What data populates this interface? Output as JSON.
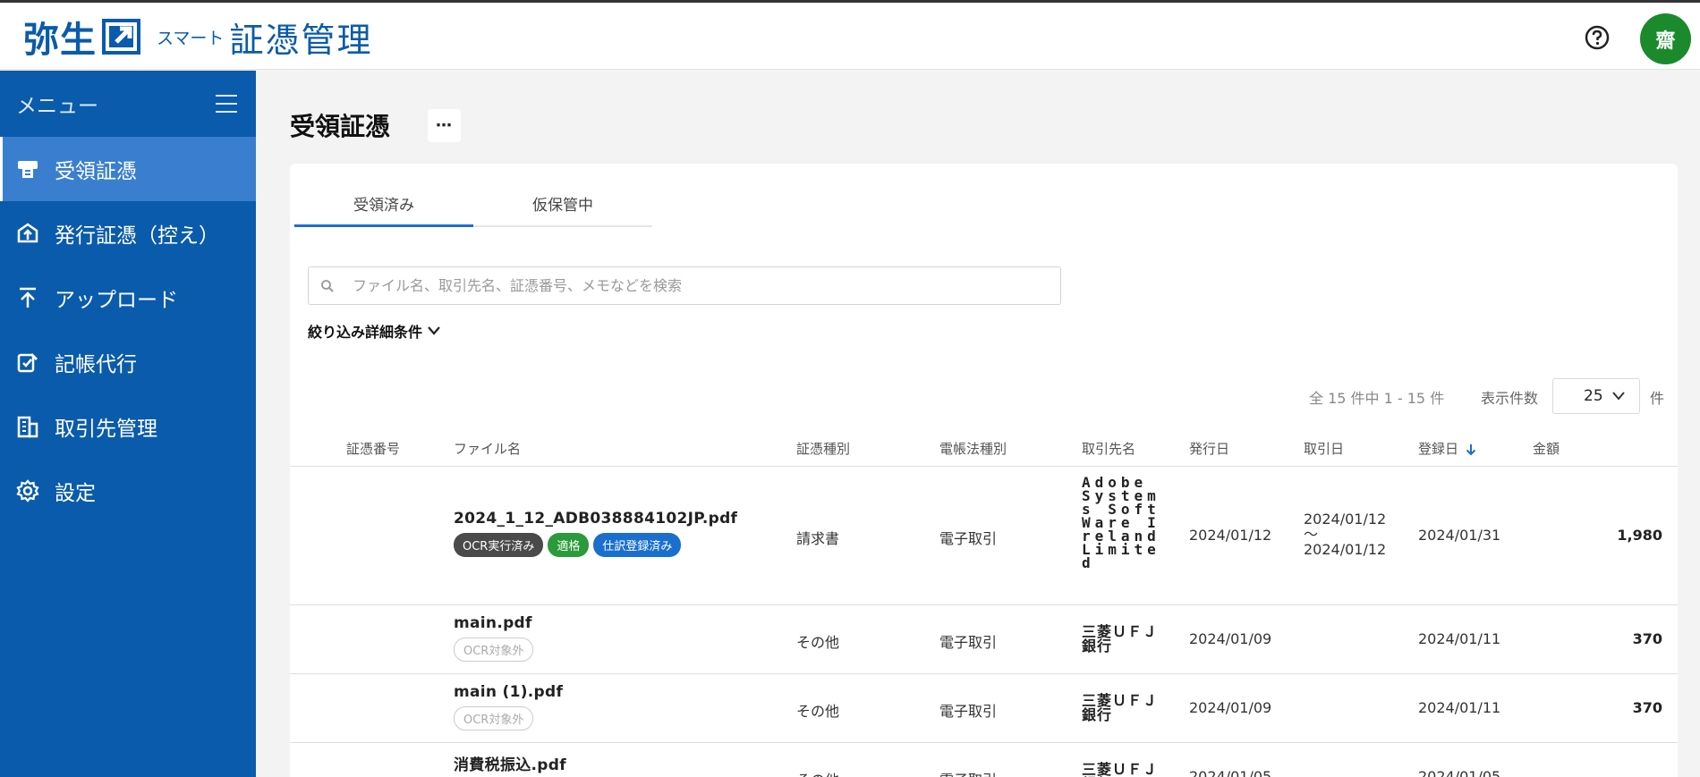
{
  "header": {
    "logo_main": "弥生",
    "logo_sub": "スマート",
    "logo_title": "証憑管理",
    "avatar_initial": "齋"
  },
  "sidebar": {
    "menu_label": "メニュー",
    "items": [
      {
        "label": "受領証憑",
        "icon": "receipt-icon",
        "active": true
      },
      {
        "label": "発行証憑（控え）",
        "icon": "issued-doc-icon",
        "active": false
      },
      {
        "label": "アップロード",
        "icon": "upload-icon",
        "active": false
      },
      {
        "label": "記帳代行",
        "icon": "bookkeeping-icon",
        "active": false
      },
      {
        "label": "取引先管理",
        "icon": "building-icon",
        "active": false
      },
      {
        "label": "設定",
        "icon": "gear-icon",
        "active": false
      }
    ]
  },
  "main": {
    "title": "受領証憑",
    "more_label": "⋯",
    "tabs": [
      {
        "label": "受領済み",
        "active": true
      },
      {
        "label": "仮保管中",
        "active": false
      }
    ],
    "search": {
      "placeholder": "ファイル名、取引先名、証憑番号、メモなどを検索",
      "value": ""
    },
    "filter_label": "絞り込み詳細条件",
    "count_text": "全 15 件中 1 - 15 件",
    "per_page_label": "表示件数",
    "per_page_value": "25",
    "per_page_unit": "件"
  },
  "table": {
    "columns": [
      "証憑番号",
      "ファイル名",
      "証憑種別",
      "電帳法種別",
      "取引先名",
      "発行日",
      "取引日",
      "登録日",
      "金額"
    ],
    "sorted_column": "登録日",
    "sort_direction": "desc",
    "rows": [
      {
        "number": "",
        "file_name": "2024_1_12_ADB038884102JP.pdf",
        "badges": [
          {
            "text": "OCR実行済み",
            "style": "dark"
          },
          {
            "text": "適格",
            "style": "green"
          },
          {
            "text": "仕訳登録済み",
            "style": "blue"
          }
        ],
        "doc_type": "請求書",
        "ebook_type": "電子取引",
        "vendor": "Adobe Systems SoftWare Ireland Limited",
        "issue_date": "2024/01/12",
        "txn_date_from": "2024/01/12",
        "txn_date_sep": "〜",
        "txn_date_to": "2024/01/12",
        "reg_date": "2024/01/31",
        "amount": "1,980"
      },
      {
        "number": "",
        "file_name": "main.pdf",
        "badges": [
          {
            "text": "OCR対象外",
            "style": "outline"
          }
        ],
        "doc_type": "その他",
        "ebook_type": "電子取引",
        "vendor": "三菱ＵＦＪ銀行",
        "issue_date": "2024/01/09",
        "reg_date": "2024/01/11",
        "amount": "370"
      },
      {
        "number": "",
        "file_name": "main (1).pdf",
        "badges": [
          {
            "text": "OCR対象外",
            "style": "outline"
          }
        ],
        "doc_type": "その他",
        "ebook_type": "電子取引",
        "vendor": "三菱ＵＦＪ銀行",
        "issue_date": "2024/01/09",
        "reg_date": "2024/01/11",
        "amount": "370"
      },
      {
        "number": "",
        "file_name": "消費税振込.pdf",
        "badges": [],
        "doc_type": "その他",
        "ebook_type": "電子取引",
        "vendor": "三菱ＵＦＪ銀行",
        "issue_date": "2024/01/05",
        "reg_date": "2024/01/05",
        "amount": ""
      }
    ]
  },
  "colors": {
    "brand_blue": "#0a5bab",
    "active_nav": "#3a7fcf",
    "accent_blue": "#1a6fce",
    "avatar_green": "#1a8a2c",
    "badge_green": "#2a9a3a"
  }
}
